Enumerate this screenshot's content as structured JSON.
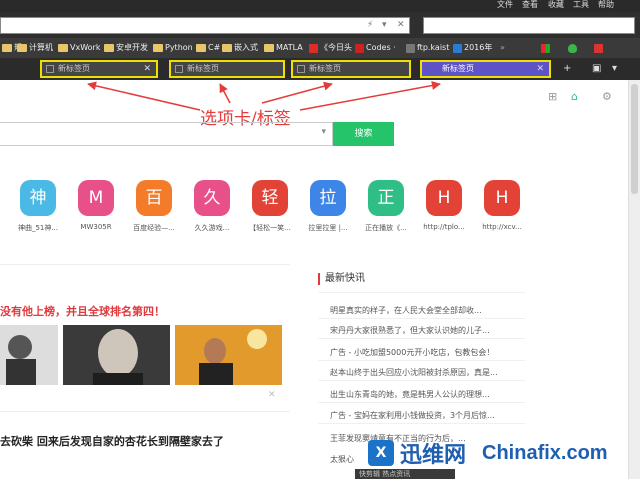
{
  "menubar": {
    "items": [
      "文件",
      "查看",
      "收藏",
      "工具",
      "帮助"
    ]
  },
  "url_icons": [
    "lightning-icon",
    "dropdown-icon",
    "close-icon"
  ],
  "bookmarks": [
    {
      "label": "规",
      "type": "folder"
    },
    {
      "label": "计算机",
      "type": "folder"
    },
    {
      "label": "VxWork",
      "type": "folder"
    },
    {
      "label": "安卓开发",
      "type": "folder"
    },
    {
      "label": "Python",
      "type": "folder"
    },
    {
      "label": "C#",
      "type": "folder"
    },
    {
      "label": "嵌入式",
      "type": "folder"
    },
    {
      "label": "MATLA",
      "type": "folder"
    },
    {
      "label": "《今日头",
      "type": "site",
      "color": "#e02b2b"
    },
    {
      "label": "Codes ·",
      "type": "site",
      "color": "#cc2222"
    },
    {
      "label": "ftp.kaist",
      "type": "site",
      "color": "#777777"
    },
    {
      "label": "2016年",
      "type": "site",
      "color": "#2a7ad6"
    }
  ],
  "tabs": [
    {
      "label": "新标签页",
      "active": false
    },
    {
      "label": "新标签页",
      "active": false
    },
    {
      "label": "新标签页",
      "active": false
    },
    {
      "label": "新标签页",
      "active": true
    }
  ],
  "annotation": {
    "text": "选项卡/标签",
    "color": "#e53b3b"
  },
  "search": {
    "button_label": "搜索"
  },
  "sites": [
    {
      "char": "神",
      "label": "神曲_51神...",
      "color": "#4ab9e6"
    },
    {
      "char": "M",
      "label": "MW305R",
      "color": "#e8508a"
    },
    {
      "char": "百",
      "label": "百度经验—...",
      "color": "#f47b2a"
    },
    {
      "char": "久",
      "label": "久久游戏...",
      "color": "#e8508a"
    },
    {
      "char": "轻",
      "label": "【轻松一笑...",
      "color": "#e34336"
    },
    {
      "char": "拉",
      "label": "拉里拉里 |...",
      "color": "#3d86e8"
    },
    {
      "char": "正",
      "label": "正在播放《...",
      "color": "#2fbf86"
    },
    {
      "char": "H",
      "label": "http://tplo...",
      "color": "#e34336"
    },
    {
      "char": "H",
      "label": "http://xcv...",
      "color": "#e34336"
    }
  ],
  "feed": {
    "headline1": "没有他上榜，并且全球排名第四！",
    "headline2": "去砍柴 回来后发现自家的杏花长到隔壁家去了"
  },
  "news": {
    "title": "最新快讯",
    "items": [
      "明星真实的样子，在人民大会堂全部却收...",
      "宋丹丹大家很熟悉了，但大家认识她的儿子...",
      "广告 - 小吃加盟5000元开小吃店，包教包会！",
      "赵本山终于出头回应小沈阳被封杀原因，真是...",
      "出生山东青岛的她，竟是韩男人公认的理想...",
      "广告 - 宝妈在家利用小钱做投资，3个月后惊...",
      "王菲发现窦靖童有不正当的行为后，...",
      "太狠心"
    ]
  },
  "bottom_bar": {
    "text": "快剪辑    热点资讯"
  },
  "watermark": {
    "cn": "迅维网",
    "en": "Chinafix.com"
  }
}
